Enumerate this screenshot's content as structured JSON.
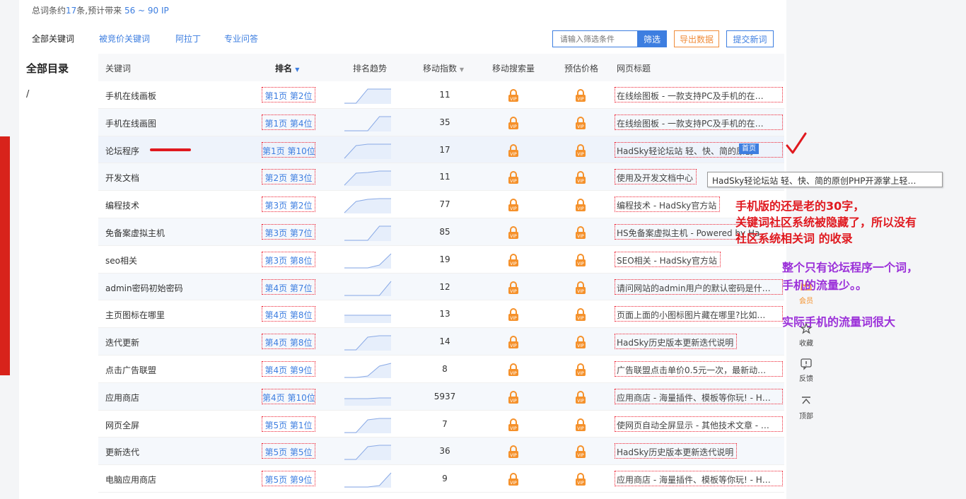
{
  "summary": {
    "prefix": "总词条约",
    "count": "17",
    "mid": "条,预计带来 ",
    "ip": "56 ~ 90 IP"
  },
  "tabs": [
    "全部关键词",
    "被竞价关键词",
    "阿拉丁",
    "专业问答"
  ],
  "filter": {
    "placeholder": "请输入筛选条件",
    "button": "筛选"
  },
  "export_label": "导出数据",
  "submit_label": "提交新词",
  "sidebar": {
    "title": "全部目录",
    "root": "/"
  },
  "table": {
    "headers": [
      "关键词",
      "排名",
      "排名趋势",
      "移动指数",
      "移动搜索量",
      "预估价格",
      "网页标题"
    ],
    "rows": [
      {
        "kw": "手机在线画板",
        "rank": "第1页 第2位",
        "idx": "11",
        "title": "在线绘图板 - 一款支持PC及手机的在…",
        "trend": [
          0,
          0,
          1,
          1,
          1
        ]
      },
      {
        "kw": "手机在线画图",
        "rank": "第1页 第4位",
        "idx": "35",
        "title": "在线绘图板 - 一款支持PC及手机的在…",
        "trend": [
          0,
          0,
          0,
          1,
          1
        ]
      },
      {
        "kw": "论坛程序",
        "rank": "第1页 第10位",
        "idx": "17",
        "title": "HadSky轻论坛站 轻、快、简的原创",
        "trend": [
          0,
          0.9,
          1,
          1,
          1
        ]
      },
      {
        "kw": "开发文档",
        "rank": "第2页 第3位",
        "idx": "11",
        "title": "使用及开发文档中心",
        "trend": [
          0,
          0.85,
          0.9,
          1,
          1
        ]
      },
      {
        "kw": "编程技术",
        "rank": "第3页 第2位",
        "idx": "77",
        "title": "编程技术 - HadSky官方站",
        "trend": [
          0,
          0.8,
          0.95,
          1,
          1
        ]
      },
      {
        "kw": "免备案虚拟主机",
        "rank": "第3页 第7位",
        "idx": "85",
        "title": "HS免备案虚拟主机 - Powered by Ha",
        "trend": [
          0,
          0,
          0,
          1,
          1
        ]
      },
      {
        "kw": "seo相关",
        "rank": "第3页 第8位",
        "idx": "19",
        "title": "SEO相关 - HadSky官方站",
        "trend": [
          0,
          0,
          0,
          0.2,
          1
        ]
      },
      {
        "kw": "admin密码初始密码",
        "rank": "第4页 第7位",
        "idx": "12",
        "title": "请问网站的admin用户的默认密码是什…",
        "trend": [
          0,
          0,
          0,
          0,
          1
        ]
      },
      {
        "kw": "主页图标在哪里",
        "rank": "第4页 第8位",
        "idx": "13",
        "title": "页面上面的小图标图片藏在哪里?比如…",
        "trend": [
          0.5,
          0.5,
          0.5,
          0.5,
          0.5
        ]
      },
      {
        "kw": "迭代更新",
        "rank": "第4页 第8位",
        "idx": "14",
        "title": "HadSky历史版本更新迭代说明",
        "trend": [
          0,
          0,
          0.9,
          1,
          1
        ]
      },
      {
        "kw": "点击广告联盟",
        "rank": "第4页 第9位",
        "idx": "8",
        "title": "广告联盟点击单价0.5元一次，最新动…",
        "trend": [
          0,
          0,
          0.1,
          0.8,
          1
        ]
      },
      {
        "kw": "应用商店",
        "rank": "第4页 第10位",
        "idx": "5937",
        "title": "应用商店 - 海量插件、模板等你玩! - H…",
        "trend": [
          0.45,
          0.45,
          0.45,
          0.5,
          0.5
        ]
      },
      {
        "kw": "网页全屏",
        "rank": "第5页 第1位",
        "idx": "7",
        "title": "使网页自动全屏显示 - 其他技术文章 - …",
        "trend": [
          0,
          0,
          0.9,
          1,
          1
        ]
      },
      {
        "kw": "更新迭代",
        "rank": "第5页 第5位",
        "idx": "36",
        "title": "HadSky历史版本更新迭代说明",
        "trend": [
          0,
          0,
          0.9,
          1,
          1
        ]
      },
      {
        "kw": "电脑应用商店",
        "rank": "第5页 第9位",
        "idx": "9",
        "title": "应用商店 - 海量插件、模板等你玩! - H…",
        "trend": [
          0,
          0,
          0,
          0.1,
          1
        ]
      }
    ]
  },
  "home_badge": "首页",
  "tooltip": "HadSky轻论坛站 轻、快、简的原创PHP开源掌上轻…",
  "notes": {
    "red": [
      "手机版的还是老的30字，",
      "关键词社区系统被隐藏了，所以没有",
      "社区系统相关词 的收录"
    ],
    "purple1": [
      "整个只有论坛程序一个词，",
      "手机的流量少。。"
    ],
    "purple2": "实际手机的流量词很大"
  },
  "side_tools": [
    "会员",
    "收藏",
    "反馈",
    "顶部"
  ],
  "colors": {
    "accent": "#3d7ee0",
    "lock": "#f5912b",
    "annotation_red": "#e0191f",
    "annotation_purple": "#9b30d9"
  }
}
